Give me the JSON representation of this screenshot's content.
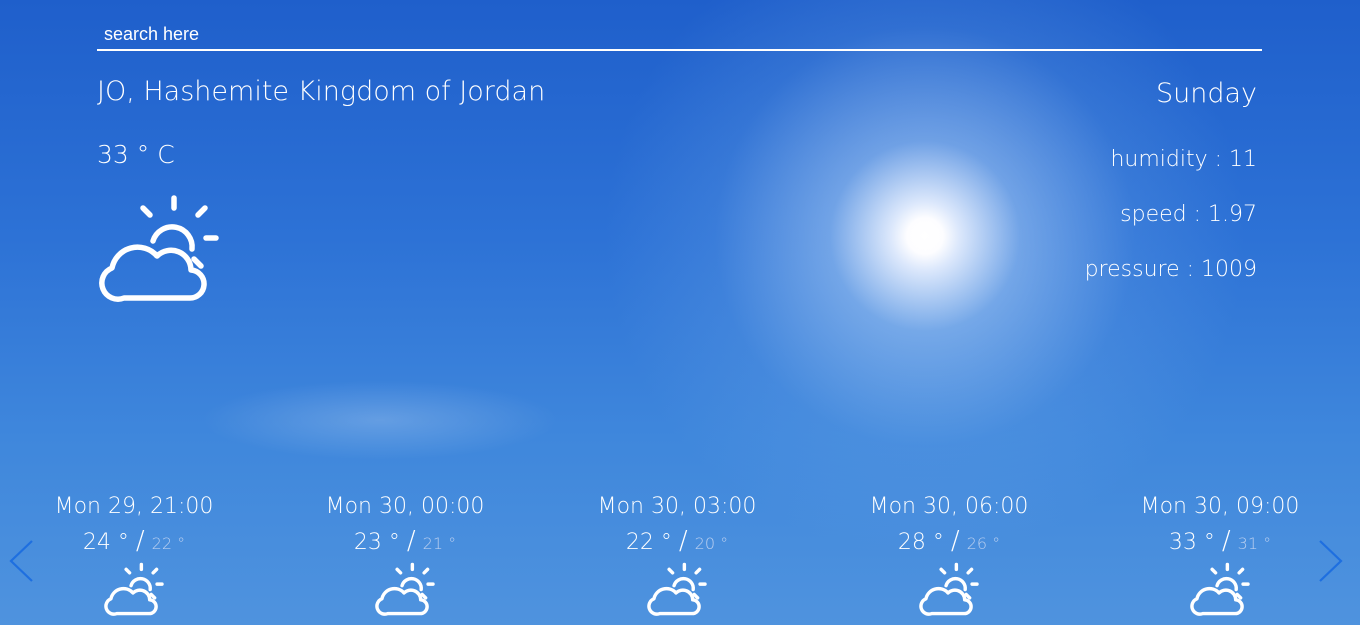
{
  "search": {
    "placeholder": "search here",
    "value": ""
  },
  "current": {
    "location": "JO, Hashemite Kingdom of Jordan",
    "temperature": "33 ° C",
    "icon": "partly-cloudy-day-icon",
    "day": "Sunday",
    "humidity": "humidity : 11",
    "speed": "speed : 1.97",
    "pressure": "pressure : 1009"
  },
  "forecast": [
    {
      "date": "Mon 29",
      "comma": ",",
      "time": " 21:00",
      "high": "24 °",
      "sep": "/",
      "low": "22 °",
      "icon": "partly-cloudy-day-icon"
    },
    {
      "date": "Mon 30",
      "comma": ",",
      "time": " 00:00",
      "high": "23 °",
      "sep": "/",
      "low": "21 °",
      "icon": "partly-cloudy-day-icon"
    },
    {
      "date": "Mon 30",
      "comma": ",",
      "time": " 03:00",
      "high": "22 °",
      "sep": "/",
      "low": "20 °",
      "icon": "partly-cloudy-day-icon"
    },
    {
      "date": "Mon 30",
      "comma": ",",
      "time": " 06:00",
      "high": "28 °",
      "sep": "/",
      "low": "26 °",
      "icon": "partly-cloudy-day-icon"
    },
    {
      "date": "Mon 30",
      "comma": ",",
      "time": " 09:00",
      "high": "33 °",
      "sep": "/",
      "low": "31 °",
      "icon": "partly-cloudy-day-icon"
    }
  ],
  "nav": {
    "prev_icon": "chevron-left-icon",
    "next_icon": "chevron-right-icon"
  },
  "colors": {
    "sky_top": "#1f5fcb",
    "sky_bottom": "#4f93de",
    "arrow": "#1e6fe0",
    "low_temp": "#b9cff0"
  }
}
